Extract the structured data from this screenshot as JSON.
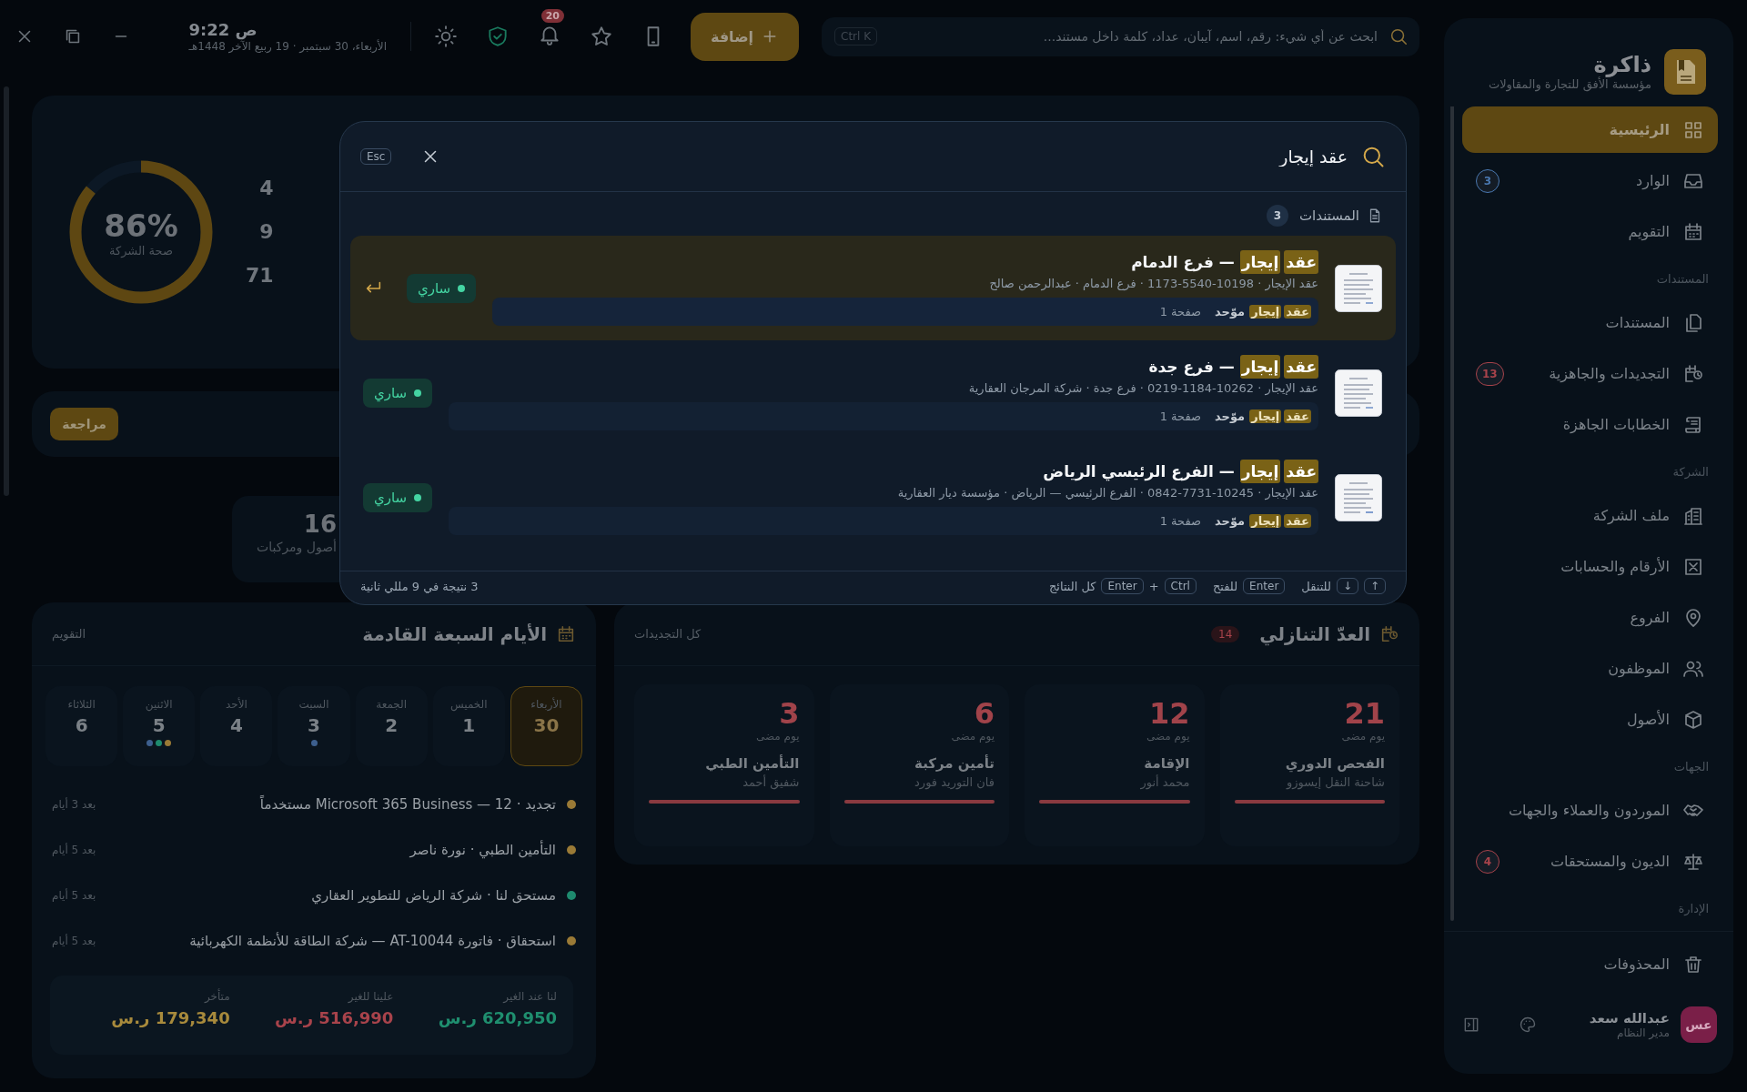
{
  "topbar": {
    "clock": {
      "time": "ص 9:22",
      "date": "الأربعاء، 30 سبتمبر · 19 ربيع الآخر 1448هـ"
    },
    "notifications_badge": "20",
    "add_button": "إضافة",
    "search": {
      "placeholder": "ابحث عن أي شيء: رقم، اسم، آيبان، عداد، كلمة داخل مستند...",
      "shortcut": "Ctrl K"
    }
  },
  "sidebar": {
    "brand": {
      "name": "ذاكرة",
      "subtitle": "مؤسسة الأفق للتجارة والمقاولات"
    },
    "groups": [
      {
        "items": [
          {
            "label": "الرئيسية",
            "selected": true
          },
          {
            "label": "الوارد",
            "selected": false,
            "badge": {
              "text": "3",
              "color": "#4a78b0"
            }
          },
          {
            "label": "التقويم",
            "selected": false
          }
        ]
      },
      {
        "title": "المستندات",
        "items": [
          {
            "label": "المستندات",
            "selected": false
          },
          {
            "label": "التجديدات والجاهزية",
            "selected": false,
            "badge": {
              "text": "13",
              "color": "#a8434b"
            }
          },
          {
            "label": "الخطابات الجاهزة",
            "selected": false
          }
        ]
      },
      {
        "title": "الشركة",
        "items": [
          {
            "label": "ملف الشركة",
            "selected": false
          },
          {
            "label": "الأرقام والحسابات",
            "selected": false
          },
          {
            "label": "الفروع",
            "selected": false
          },
          {
            "label": "الموظفون",
            "selected": false
          },
          {
            "label": "الأصول",
            "selected": false
          }
        ]
      },
      {
        "title": "الجهات",
        "items": [
          {
            "label": "الموردون والعملاء والجهات",
            "selected": false
          },
          {
            "label": "الديون والمستحقات",
            "selected": false,
            "badge": {
              "text": "4",
              "color": "#a8434b"
            }
          }
        ]
      },
      {
        "title": "الإدارة"
      }
    ],
    "deleted_item": {
      "label": "المحذوفات",
      "selected": false
    },
    "user": {
      "initials": "عس",
      "name": "عبدالله سعد",
      "role": "مدير النظام"
    }
  },
  "health": {
    "value": "86%",
    "label": "صحة الشركة",
    "level": 0.86,
    "stats": [
      "4",
      "9",
      "71"
    ]
  },
  "review_button": "مراجعة",
  "asset_card": {
    "value": "16",
    "label": "أصول ومركبات"
  },
  "calendar": {
    "title": "الأيام السبعة القادمة",
    "link": "التقويم",
    "days": [
      {
        "name": "الأربعاء",
        "number": "30",
        "selected": true
      },
      {
        "name": "الخميس",
        "number": "1",
        "selected": false
      },
      {
        "name": "الجمعة",
        "number": "2",
        "selected": false
      },
      {
        "name": "السبت",
        "number": "3",
        "selected": false,
        "dots": [
          {
            "color": "#3d5f8e"
          }
        ]
      },
      {
        "name": "الأحد",
        "number": "4",
        "selected": false
      },
      {
        "name": "الاثنين",
        "number": "5",
        "selected": false,
        "dots": [
          {
            "color": "#3d5f8e"
          },
          {
            "color": "#1e8a6e"
          },
          {
            "color": "#9a7a36"
          }
        ]
      },
      {
        "name": "الثلاثاء",
        "number": "6",
        "selected": false
      }
    ],
    "events": [
      {
        "text": "تجديد · 12 — Microsoft 365 Business مستخدماً",
        "when": "بعد 3 أيام",
        "color": "#9a7a36"
      },
      {
        "text": "التأمين الطبي · نورة ناصر",
        "when": "بعد 5 أيام",
        "color": "#9a7a36"
      },
      {
        "text": "مستحق لنا · شركة الرياض للتطوير العقاري",
        "when": "بعد 5 أيام",
        "color": "#1e8a6e"
      },
      {
        "text": "استحقاق · فاتورة AT-10044 — شركة الطاقة للأنظمة الكهربائية",
        "when": "بعد 5 أيام",
        "color": "#9a7a36"
      }
    ],
    "totals": [
      {
        "label": "لنا عند الغير",
        "value": "620,950 ر.س",
        "color": "#1f8f6f"
      },
      {
        "label": "علينا للغير",
        "value": "516,990 ر.س",
        "color": "#a8434b"
      },
      {
        "label": "متأخر",
        "value": "179,340 ر.س",
        "color": "#a88a3c"
      }
    ]
  },
  "countdown": {
    "title": "العدّ التنازلي",
    "count": "14",
    "link": "كل التجديدات",
    "items": [
      {
        "days": "21",
        "unit": "يوم مضى",
        "title": "الفحص الدوري",
        "subtitle": "شاحنة النقل إيسوزو",
        "level": 1
      },
      {
        "days": "12",
        "unit": "يوم مضى",
        "title": "الإقامة",
        "subtitle": "محمد أنور",
        "level": 1
      },
      {
        "days": "6",
        "unit": "يوم مضى",
        "title": "تأمين مركبة",
        "subtitle": "فان التوريد فورد",
        "level": 1
      },
      {
        "days": "3",
        "unit": "يوم مضى",
        "title": "التأمين الطبي",
        "subtitle": "شفيق أحمد",
        "level": 1
      }
    ]
  },
  "search_dialog": {
    "query": "عقد إيجار",
    "esc": "Esc",
    "group": {
      "title": "المستندات",
      "count": "3"
    },
    "results": [
      {
        "selected": true,
        "title": [
          {
            "text": "عقد",
            "highlight": true
          },
          {
            "text": "إيجار",
            "highlight": true
          },
          {
            "text": "— فرع الدمام",
            "highlight": false
          }
        ],
        "meta": "عقد الإيجار · 10198-5540-1173 · فرع الدمام · عبدالرحمن صالح",
        "snippet": [
          {
            "text": "عقد",
            "highlight": true
          },
          {
            "text": "إيجار",
            "highlight": true
          },
          {
            "text": "موّحد",
            "highlight": false
          }
        ],
        "page": "صفحة 1",
        "status": "ساري"
      },
      {
        "selected": false,
        "title": [
          {
            "text": "عقد",
            "highlight": true
          },
          {
            "text": "إيجار",
            "highlight": true
          },
          {
            "text": "— فرع جدة",
            "highlight": false
          }
        ],
        "meta": "عقد الإيجار · 10262-1184-0219 · فرع جدة · شركة المرجان العقارية",
        "snippet": [
          {
            "text": "عقد",
            "highlight": true
          },
          {
            "text": "إيجار",
            "highlight": true
          },
          {
            "text": "موّحد",
            "highlight": false
          }
        ],
        "page": "صفحة 1",
        "status": "ساري"
      },
      {
        "selected": false,
        "title": [
          {
            "text": "عقد",
            "highlight": true
          },
          {
            "text": "إيجار",
            "highlight": true
          },
          {
            "text": "— الفرع الرئيسي الرياض",
            "highlight": false
          }
        ],
        "meta": "عقد الإيجار · 10245-7731-0842 · الفرع الرئيسي — الرياض · مؤسسة ديار العقارية",
        "snippet": [
          {
            "text": "عقد",
            "highlight": true
          },
          {
            "text": "إيجار",
            "highlight": true
          },
          {
            "text": "موّحد",
            "highlight": false
          }
        ],
        "page": "صفحة 1",
        "status": "ساري"
      }
    ],
    "hints": [
      {
        "keys": [
          {
            "kind": "key",
            "text": "↑"
          },
          {
            "kind": "key",
            "text": "↓"
          }
        ],
        "label": "للتنقل"
      },
      {
        "keys": [
          {
            "kind": "key",
            "text": "Enter"
          }
        ],
        "label": "للفتح"
      },
      {
        "keys": [
          {
            "kind": "key",
            "text": "Ctrl"
          },
          {
            "kind": "plus",
            "text": "+"
          },
          {
            "kind": "key",
            "text": "Enter"
          }
        ],
        "label": "كل النتائج"
      }
    ],
    "summary": "3 نتيجة في 9 مللي ثانية"
  }
}
